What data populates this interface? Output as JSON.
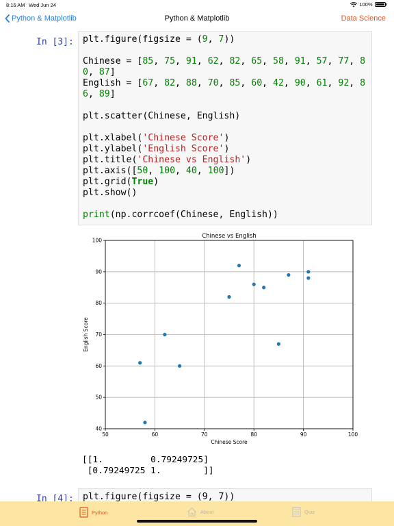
{
  "status": {
    "time": "8:16 AM",
    "date": "Wed Jun 24",
    "battery": "100%"
  },
  "nav": {
    "back_label": "Python & Matplotlib",
    "title": "Python & Matplotlib",
    "right_label": "Data Science"
  },
  "cells": [
    {
      "prompt": "In [3]:"
    },
    {
      "prompt": "In [4]:",
      "first_line": "plt.figure(figsize = (9, 7))"
    }
  ],
  "output": {
    "line1": "[[1.         0.79249725]",
    "line2": " [0.79249725 1.        ]]"
  },
  "chart_data": {
    "type": "scatter",
    "title": "Chinese vs English",
    "xlabel": "Chinese Score",
    "ylabel": "English Score",
    "xlim": [
      50,
      100
    ],
    "ylim": [
      40,
      100
    ],
    "xticks": [
      50,
      60,
      70,
      80,
      90,
      100
    ],
    "yticks": [
      40,
      50,
      60,
      70,
      80,
      90,
      100
    ],
    "grid": true,
    "color": "#1f77b4",
    "x": [
      85,
      75,
      91,
      62,
      82,
      65,
      58,
      91,
      57,
      77,
      80,
      87
    ],
    "y": [
      67,
      82,
      88,
      70,
      85,
      60,
      42,
      90,
      61,
      92,
      86,
      89
    ]
  },
  "tabs": [
    {
      "label": "Python",
      "icon": "python-book-icon",
      "active": true
    },
    {
      "label": "About",
      "icon": "house-icon",
      "active": false
    },
    {
      "label": "Quiz",
      "icon": "quiz-icon",
      "active": false
    }
  ],
  "colors": {
    "accent": "#e0541c",
    "link": "#2a7cd6",
    "tabbar": "#fde6a3",
    "prompt": "#303f9f"
  }
}
